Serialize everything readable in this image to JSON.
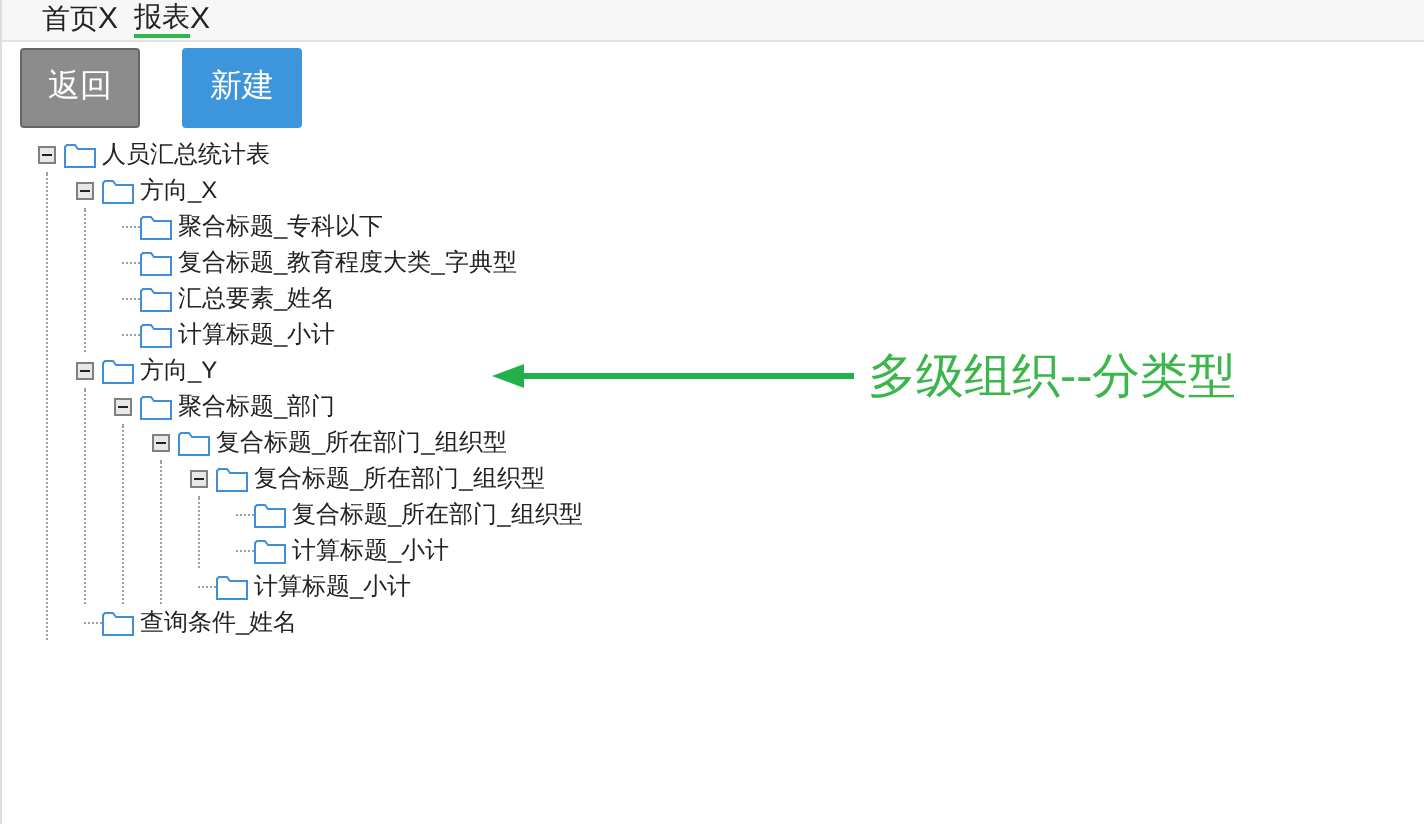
{
  "tabs": [
    {
      "label": "首页",
      "close": "X",
      "selected": false
    },
    {
      "label": "报表",
      "close": "X",
      "selected": true
    }
  ],
  "buttons": [
    {
      "label": "返回",
      "kind": "secondary"
    },
    {
      "label": "新建",
      "kind": "primary"
    }
  ],
  "tree": [
    {
      "label": "人员汇总统计表",
      "expanded": true,
      "children": [
        {
          "label": "方向_X",
          "expanded": true,
          "children": [
            {
              "label": "聚合标题_专科以下"
            },
            {
              "label": "复合标题_教育程度大类_字典型"
            },
            {
              "label": "汇总要素_姓名"
            },
            {
              "label": "计算标题_小计"
            }
          ]
        },
        {
          "label": "方向_Y",
          "expanded": true,
          "children": [
            {
              "label": "聚合标题_部门",
              "expanded": true,
              "children": [
                {
                  "label": "复合标题_所在部门_组织型",
                  "expanded": true,
                  "children": [
                    {
                      "label": "复合标题_所在部门_组织型",
                      "expanded": true,
                      "children": [
                        {
                          "label": "复合标题_所在部门_组织型"
                        },
                        {
                          "label": "计算标题_小计"
                        }
                      ]
                    },
                    {
                      "label": "计算标题_小计"
                    }
                  ]
                }
              ]
            }
          ]
        },
        {
          "label": "查询条件_姓名"
        }
      ]
    }
  ],
  "annotation": {
    "text": "多级组织--分类型"
  }
}
